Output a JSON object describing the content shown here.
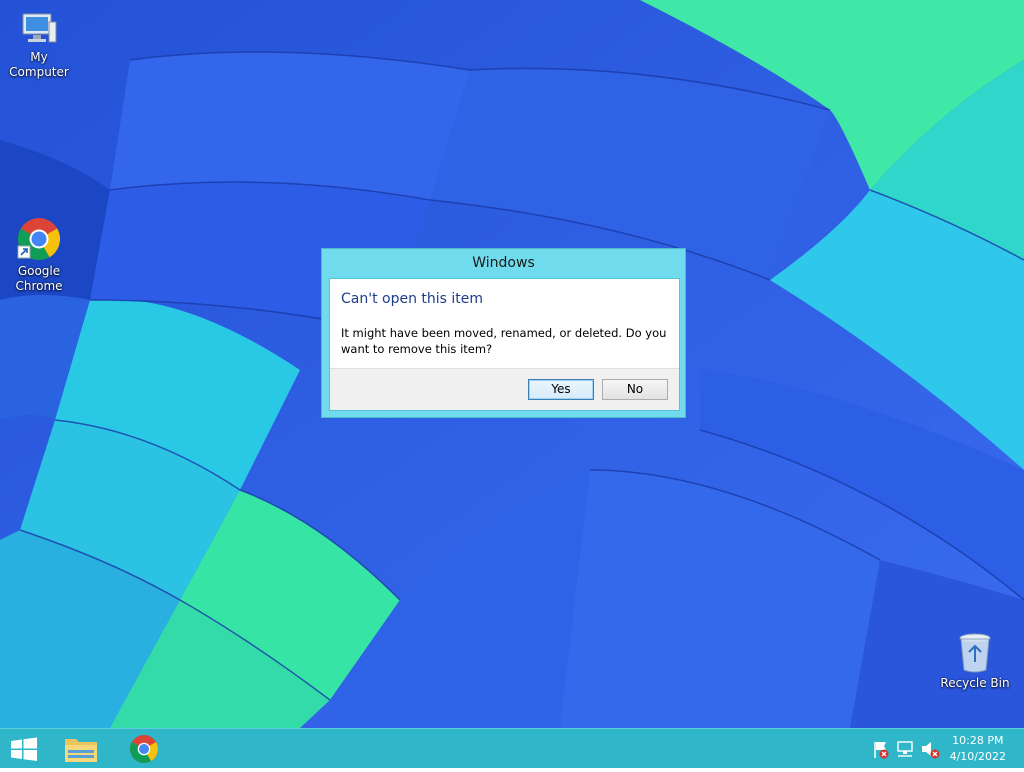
{
  "desktop": {
    "icons": [
      {
        "label": "My Computer",
        "icon": "computer-icon"
      },
      {
        "label": "Google\nChrome",
        "icon": "chrome-icon"
      },
      {
        "label": "Recycle Bin",
        "icon": "recycle-bin-icon"
      }
    ]
  },
  "dialog": {
    "title": "Windows",
    "heading": "Can't open this item",
    "message": "It might have been moved, renamed, or deleted. Do you want to remove this item?",
    "yes_label": "Yes",
    "no_label": "No"
  },
  "taskbar": {
    "items": [
      {
        "icon": "start-windows-icon"
      },
      {
        "icon": "file-explorer-icon"
      },
      {
        "icon": "chrome-icon"
      }
    ],
    "tray_icons": [
      "action-center-flag-icon",
      "network-icon",
      "volume-muted-icon"
    ],
    "clock": {
      "time": "10:28 PM",
      "date": "4/10/2022"
    }
  },
  "colors": {
    "taskbar": "#2fb7c9",
    "dialog_frame": "#6fdbec",
    "heading_text": "#1c3d8c"
  }
}
